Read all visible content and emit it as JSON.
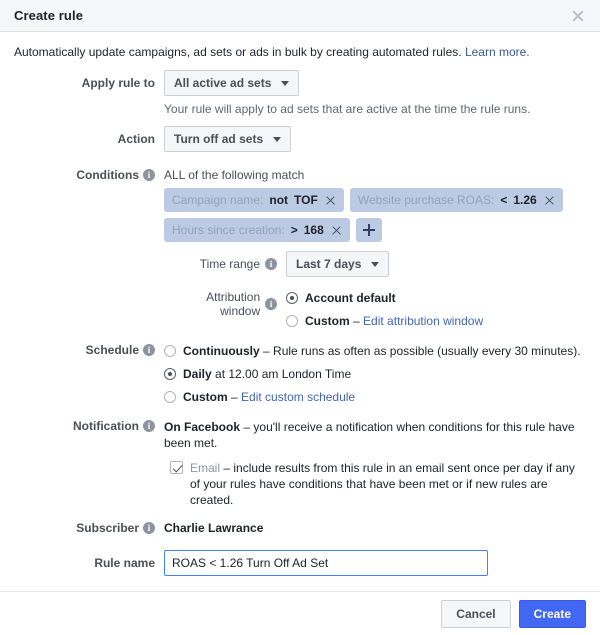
{
  "dialog": {
    "title": "Create rule",
    "close_icon": "close-icon",
    "intro_text": "Automatically update campaigns, ad sets or ads in bulk by creating automated rules.",
    "intro_link": "Learn more."
  },
  "apply_rule_to": {
    "label": "Apply rule to",
    "value": "All active ad sets",
    "helper": "Your rule will apply to ad sets that are active at the time the rule runs."
  },
  "action": {
    "label": "Action",
    "value": "Turn off ad sets"
  },
  "conditions": {
    "label": "Conditions",
    "info_icon": "info-icon",
    "match_text": "ALL of the following match",
    "pills": [
      {
        "key": "Campaign name:",
        "operator": "not",
        "value": "TOF",
        "remove_icon": "close-icon"
      },
      {
        "key": "Website purchase ROAS:",
        "operator": "<",
        "value": "1.26",
        "remove_icon": "close-icon"
      },
      {
        "key": "Hours since creation:",
        "operator": ">",
        "value": "168",
        "remove_icon": "close-icon"
      }
    ],
    "add_label": "+"
  },
  "time_range": {
    "label": "Time range",
    "value": "Last 7 days"
  },
  "attribution_window": {
    "label": "Attribution window",
    "options": [
      {
        "label": "Account default",
        "selected": true,
        "link": ""
      },
      {
        "label": "Custom",
        "selected": false,
        "dash": "–",
        "link": "Edit attribution window"
      }
    ]
  },
  "schedule": {
    "label": "Schedule",
    "options": [
      {
        "label": "Continuously",
        "dash": "–",
        "desc": "Rule runs as often as possible (usually every 30 minutes).",
        "selected": false,
        "link": ""
      },
      {
        "label": "Daily",
        "dash": "",
        "desc": "at 12.00 am London Time",
        "selected": true,
        "link": ""
      },
      {
        "label": "Custom",
        "dash": "–",
        "desc": "",
        "selected": false,
        "link": "Edit custom schedule"
      }
    ]
  },
  "notification": {
    "label": "Notification",
    "facebook": {
      "label": "On Facebook",
      "dash": "–",
      "desc": "you'll receive a notification when conditions for this rule have been met."
    },
    "email": {
      "label": "Email",
      "dash": "–",
      "desc": "include results from this rule in an email sent once per day if any of your rules have conditions that have been met or if new rules are created.",
      "checked": true
    }
  },
  "subscriber": {
    "label": "Subscriber",
    "value": "Charlie Lawrance"
  },
  "rule_name": {
    "label": "Rule name",
    "value": "ROAS < 1.26 Turn Off Ad Set",
    "placeholder": "Rule name"
  },
  "footer": {
    "cancel_label": "Cancel",
    "create_label": "Create"
  },
  "colors": {
    "accent": "#4267f2",
    "link": "#385898",
    "pill_bg": "#bdcae4",
    "header_bg": "#f5f6f7"
  }
}
